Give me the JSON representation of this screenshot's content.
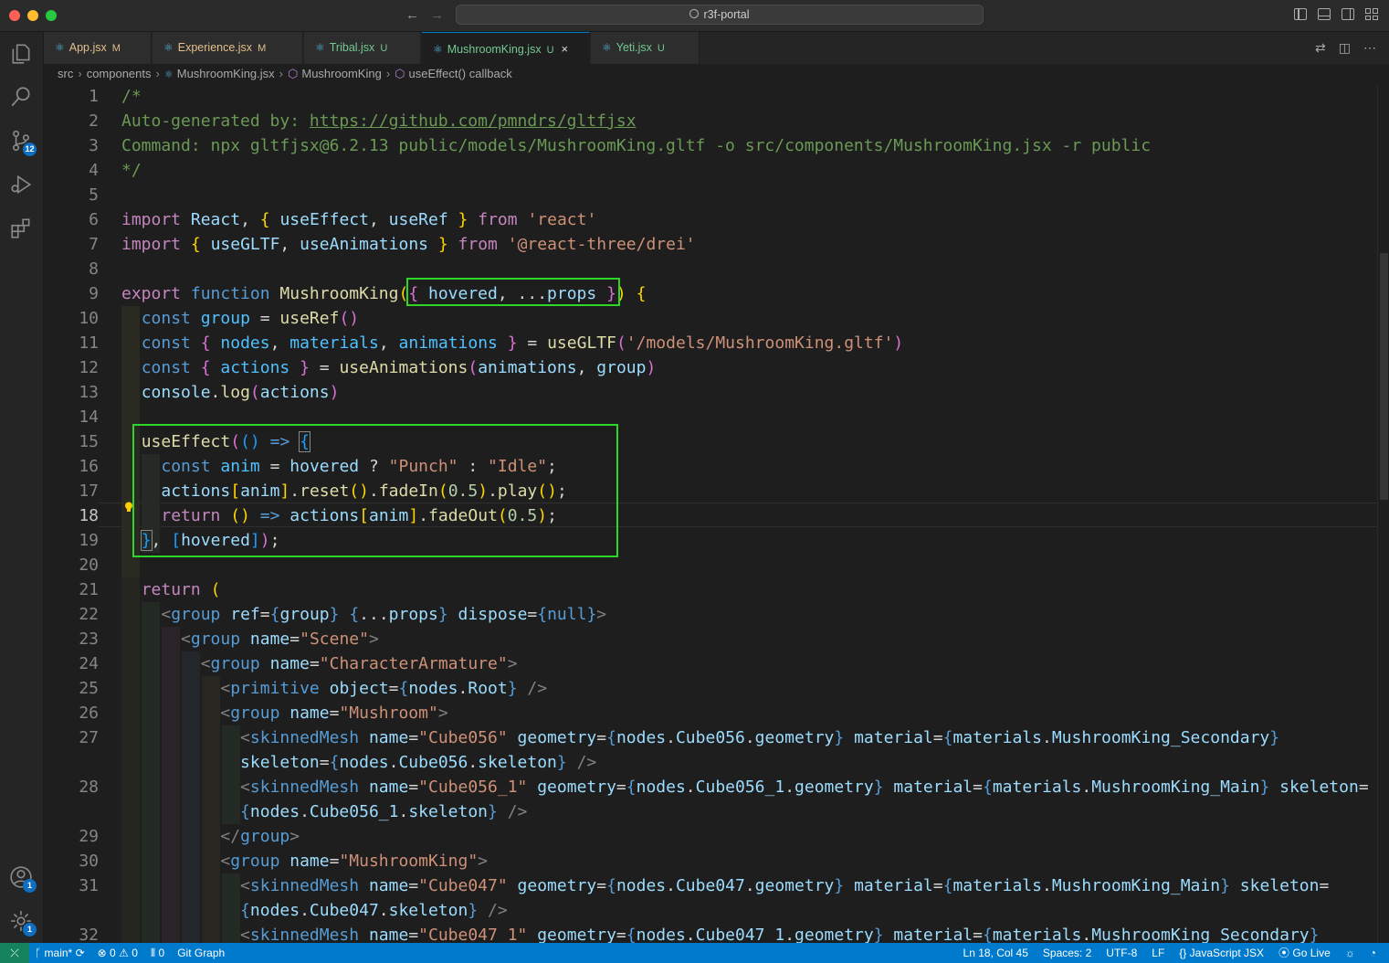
{
  "window": {
    "search": "r3f-portal"
  },
  "tabs": [
    {
      "name": "App.jsx",
      "status": "M"
    },
    {
      "name": "Experience.jsx",
      "status": "M"
    },
    {
      "name": "Tribal.jsx",
      "status": "U"
    },
    {
      "name": "MushroomKing.jsx",
      "status": "U",
      "close": "×"
    },
    {
      "name": "Yeti.jsx",
      "status": "U"
    }
  ],
  "breadcrumb": [
    "src",
    "components",
    "MushroomKing.jsx",
    "MushroomKing",
    "useEffect() callback"
  ],
  "activity": {
    "scm_badge": "12",
    "accounts_badge": "1",
    "settings_badge": "1"
  },
  "line_numbers": [
    "1",
    "2",
    "3",
    "4",
    "5",
    "6",
    "7",
    "8",
    "9",
    "10",
    "11",
    "12",
    "13",
    "14",
    "15",
    "16",
    "17",
    "18",
    "19",
    "20",
    "21",
    "22",
    "23",
    "24",
    "25",
    "26",
    "27",
    "",
    "28",
    "",
    "29",
    "30",
    "31",
    "",
    "32"
  ],
  "code": {
    "l1": "/*",
    "l2a": "Auto-generated by: ",
    "l2b": "https://github.com/pmndrs/gltfjsx",
    "l3": "Command: npx gltfjsx@6.2.13 public/models/MushroomKing.gltf -o src/components/MushroomKing.jsx -r public",
    "l4": "*/",
    "import": "import",
    "from": "from",
    "react_str": "'react'",
    "drei_str": "'@react-three/drei'",
    "React": "React",
    "useEffect": "useEffect",
    "useRef": "useRef",
    "useGLTF": "useGLTF",
    "useAnimations": "useAnimations",
    "export": "export",
    "function": "function",
    "MushroomKing": "MushroomKing",
    "hovered": "hovered",
    "props": "props",
    "const": "const",
    "group": "group",
    "nodes": "nodes",
    "materials": "materials",
    "animations": "animations",
    "actions": "actions",
    "gltf_path": "'/models/MushroomKing.gltf'",
    "console": "console",
    "log": "log",
    "anim": "anim",
    "punch": "\"Punch\"",
    "idle": "\"Idle\"",
    "reset": "reset",
    "fadeIn": "fadeIn",
    "play": "play",
    "fadeOut": "fadeOut",
    "half": "0.5",
    "return": "return",
    "ref": "ref",
    "dispose": "dispose",
    "null": "null",
    "name": "name",
    "scene": "\"Scene\"",
    "armature": "\"CharacterArmature\"",
    "primitive": "primitive",
    "object": "object",
    "Root": "Root",
    "mushroom": "\"Mushroom\"",
    "skinnedMesh": "skinnedMesh",
    "geometry": "geometry",
    "material": "material",
    "skeleton": "skeleton",
    "Cube056": "Cube056",
    "Cube056s": "\"Cube056\"",
    "Cube056_1": "Cube056_1",
    "Cube056_1s": "\"Cube056_1\"",
    "Cube047": "Cube047",
    "Cube047s": "\"Cube047\"",
    "Cube047_1": "Cube047_1",
    "Cube047_1s": "\"Cube047_1\"",
    "mk_secondary": "MushroomKing_Secondary",
    "mk_main": "MushroomKing_Main",
    "mushroomking_str": "\"MushroomKing\"",
    "grp": "group"
  },
  "status": {
    "branch": "main*",
    "errors": "0",
    "warnings": "0",
    "ports": "0",
    "git_graph": "Git Graph",
    "position": "Ln 18, Col 45",
    "spaces": "Spaces: 2",
    "encoding": "UTF-8",
    "eol": "LF",
    "language": "JavaScript JSX",
    "golive": "Go Live"
  },
  "colors": {
    "accent": "#007acc",
    "highlight_box": "#2ed52b"
  }
}
